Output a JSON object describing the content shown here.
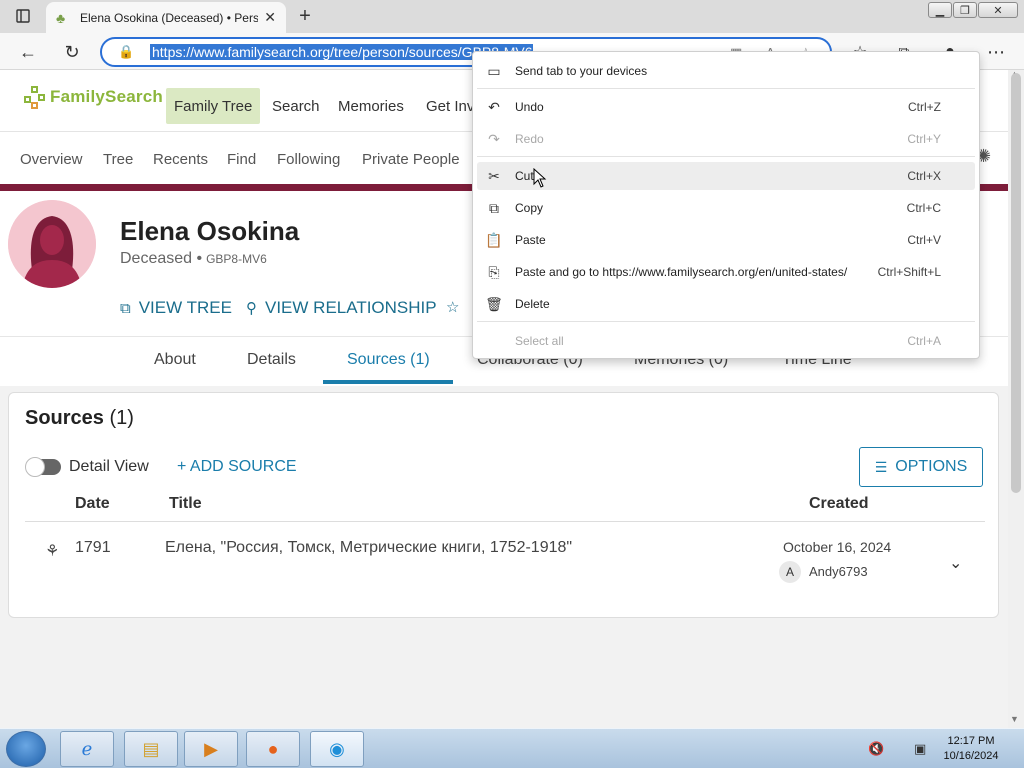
{
  "browser": {
    "tab_title": "Elena Osokina (Deceased) • Pers",
    "url": "https://www.familysearch.org/tree/person/sources/GBP8-MV6"
  },
  "site": {
    "logo_text": "FamilySearch",
    "main_nav": [
      "Family Tree",
      "Search",
      "Memories",
      "Get Inv"
    ],
    "sub_nav": [
      "Overview",
      "Tree",
      "Recents",
      "Find",
      "Following",
      "Private People"
    ]
  },
  "person": {
    "name": "Elena Osokina",
    "status": "Deceased",
    "id": "GBP8-MV6",
    "actions": {
      "view_tree": "VIEW TREE",
      "view_relationship": "VIEW RELATIONSHIP"
    }
  },
  "tabs": [
    "About",
    "Details",
    "Sources (1)",
    "Collaborate (0)",
    "Memories (0)",
    "Time Line"
  ],
  "sources": {
    "title": "Sources",
    "count": "(1)",
    "detail_view_label": "Detail View",
    "add_source_label": "+ ADD SOURCE",
    "options_label": "OPTIONS",
    "columns": {
      "date": "Date",
      "title": "Title",
      "created": "Created"
    },
    "rows": [
      {
        "date": "1791",
        "title": "Елена, \"Россия, Томск, Метрические книги, 1752-1918\"",
        "created_date": "October 16, 2024",
        "user_initial": "A",
        "user": "Andy6793"
      }
    ]
  },
  "context_menu": {
    "items": [
      {
        "label": "Send tab to your devices",
        "shortcut": "",
        "icon": "device-icon",
        "disabled": false
      },
      {
        "label": "Undo",
        "shortcut": "Ctrl+Z",
        "icon": "undo-icon",
        "disabled": false
      },
      {
        "label": "Redo",
        "shortcut": "Ctrl+Y",
        "icon": "redo-icon",
        "disabled": true
      },
      {
        "label": "Cut",
        "shortcut": "Ctrl+X",
        "icon": "scissors-icon",
        "disabled": false
      },
      {
        "label": "Copy",
        "shortcut": "Ctrl+C",
        "icon": "copy-icon",
        "disabled": false
      },
      {
        "label": "Paste",
        "shortcut": "Ctrl+V",
        "icon": "paste-icon",
        "disabled": false
      },
      {
        "label": "Paste and go to https://www.familysearch.org/en/united-states/",
        "shortcut": "Ctrl+Shift+L",
        "icon": "paste-go-icon",
        "disabled": false
      },
      {
        "label": "Delete",
        "shortcut": "",
        "icon": "trash-icon",
        "disabled": false
      },
      {
        "label": "Select all",
        "shortcut": "Ctrl+A",
        "icon": "",
        "disabled": true
      }
    ]
  },
  "taskbar": {
    "time": "12:17 PM",
    "date": "10/16/2024"
  },
  "colors": {
    "accent_blue": "#1a7dab",
    "brand_green": "#8cb63c",
    "header_bar": "#7d1d3a",
    "active_nav_bg": "#dbe9c3"
  }
}
